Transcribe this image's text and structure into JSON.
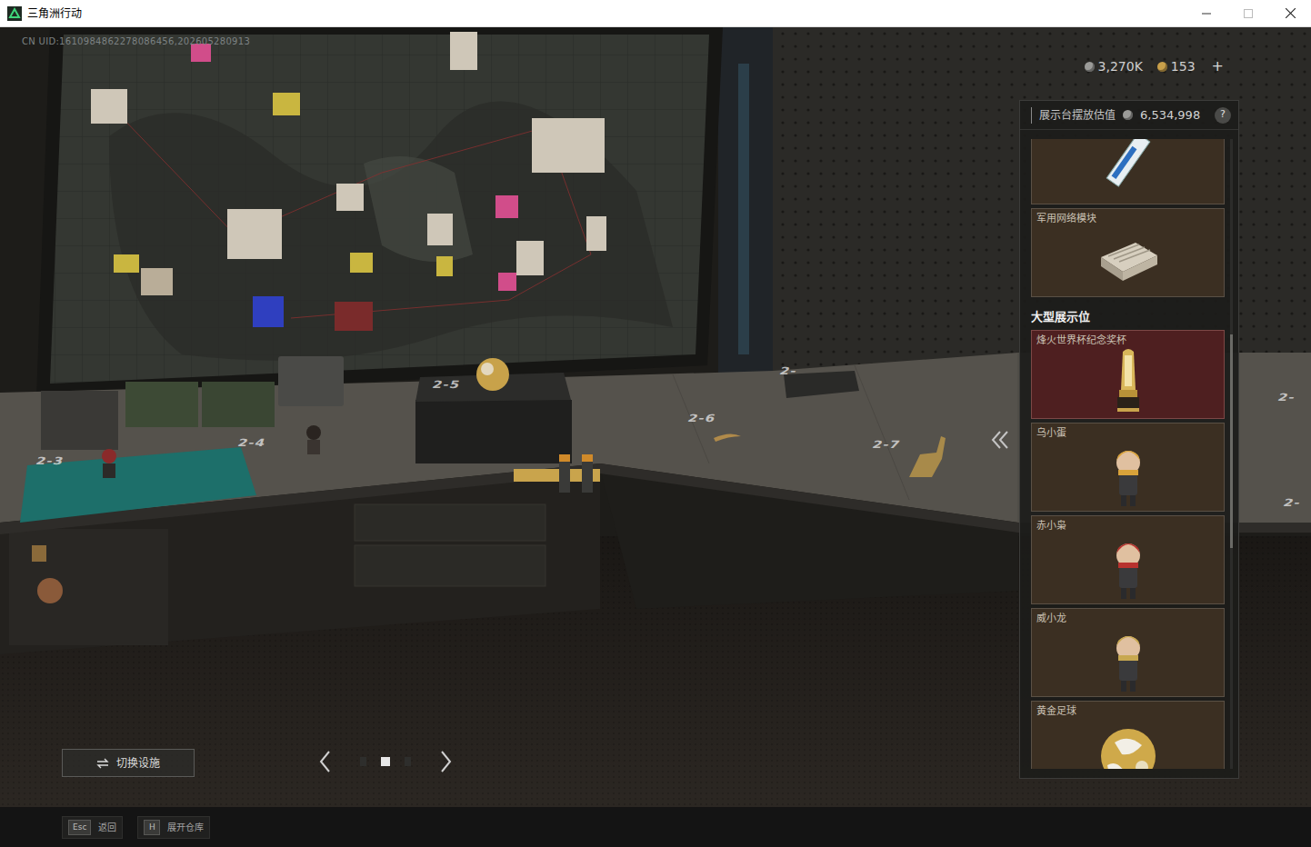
{
  "window": {
    "title": "三角洲行动"
  },
  "hud": {
    "uid": "CN UID:1610984862278086456,202605280913",
    "currencies": [
      {
        "amount": "3,270K",
        "color": "#9b9b98"
      },
      {
        "amount": "153",
        "color": "#c9a04a"
      }
    ],
    "add": "+"
  },
  "scene": {
    "slots": [
      {
        "label": "2-3"
      },
      {
        "label": "2-4"
      },
      {
        "label": "2-5"
      },
      {
        "label": "2-6"
      },
      {
        "label": "2-7"
      },
      {
        "label": "2-"
      },
      {
        "label": "2-"
      },
      {
        "label": "2-"
      }
    ]
  },
  "panel": {
    "title": "展示台摆放估值",
    "value": "6,534,998",
    "help": "?",
    "scroll": {
      "start": 0.31,
      "level": 0.34
    },
    "top_items": [
      {
        "kind": "memory",
        "selected": false
      },
      {
        "label": "军用网络模块",
        "kind": "module",
        "selected": false
      }
    ],
    "section": {
      "heading": "大型展示位",
      "items": [
        {
          "label": "烽火世界杯纪念奖杯",
          "kind": "trophy",
          "selected": true
        },
        {
          "label": "乌小蛋",
          "kind": "figure",
          "selected": false,
          "color": "#d8a23a"
        },
        {
          "label": "赤小枭",
          "kind": "figure",
          "selected": false,
          "color": "#b8322e"
        },
        {
          "label": "威小龙",
          "kind": "figure",
          "selected": false,
          "color": "#c8a850"
        },
        {
          "label": "黄金足球",
          "kind": "ball",
          "selected": false
        }
      ]
    }
  },
  "bottom": {
    "switch_button": "切换设施",
    "pager": [
      {
        "selected": false
      },
      {
        "selected": true
      },
      {
        "selected": false
      }
    ],
    "hints": [
      {
        "key": "Esc",
        "label": "返回"
      },
      {
        "key": "H",
        "label": "展开仓库"
      }
    ]
  }
}
